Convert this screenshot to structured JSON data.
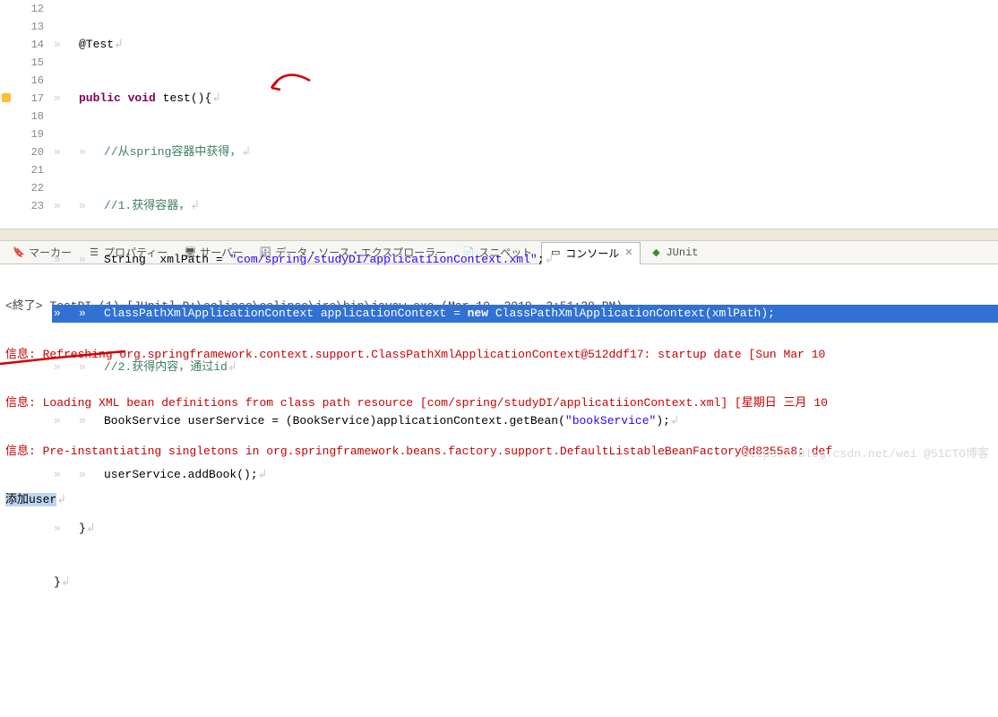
{
  "gutter": [
    "12",
    "13",
    "14",
    "15",
    "16",
    "17",
    "18",
    "19",
    "20",
    "21",
    "22",
    "23"
  ],
  "code": {
    "l12": {
      "ann": "@Test"
    },
    "l13": {
      "kw1": "public",
      "kw2": "void",
      "fn": " test(){"
    },
    "l14": {
      "cm": "//从spring容器中获得，"
    },
    "l15": {
      "cm": "//1.获得容器，"
    },
    "l16": {
      "t1": "String  xmlPath = ",
      "s": "\"com/spring/studyDI/applicatiionContext.xml\"",
      "t2": ";"
    },
    "l17": {
      "sel": "ClassPathXmlApplicationContext applicationContext = ",
      "kw": "new",
      "sel2": " ClassPathXmlApplicationContext(xmlPath);"
    },
    "l18": {
      "cm": "//2.获得内容，通过id"
    },
    "l19": {
      "t1": "BookService userService = (BookService)applicationContext.getBean(",
      "s": "\"bookService\"",
      "t2": ");"
    },
    "l20": {
      "t": "userService.addBook();"
    },
    "l21": {
      "t": "}"
    },
    "l22": {
      "t": "}"
    }
  },
  "tabs": {
    "marker": "マーカー",
    "property": "プロパティー",
    "server": "サーバー",
    "dse": "データ・ソース・エクスプローラー",
    "snippet": "スニペット",
    "console": "コンソール",
    "junit": "JUnit"
  },
  "console": {
    "term": "<終了> TestDI (1) [JUnit] D:\\eclipse\\eclipse\\jre\\bin\\javaw.exe (Mar 10, 2019, 2:51:29 PM)",
    "l1": "信息: Refreshing org.springframework.context.support.ClassPathXmlApplicationContext@512ddf17: startup date [Sun Mar 10 ",
    "l2": "信息: Loading XML bean definitions from class path resource [com/spring/studyDI/applicatiionContext.xml] [星期日 三月 10",
    "l3": "信息: Pre-instantiating singletons in org.springframework.beans.factory.support.DefaultListableBeanFactory@d8355a8: def",
    "l4a": "添加user",
    "l4b": "↲"
  },
  "watermark": "https://blog.csdn.net/wei @51CTO博客"
}
